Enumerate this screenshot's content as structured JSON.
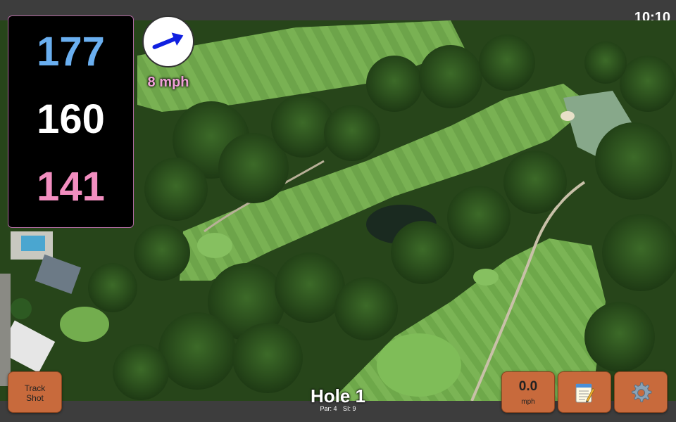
{
  "clock": "10:10",
  "distances": {
    "back": "177",
    "middle": "160",
    "front": "141",
    "colors": {
      "back": "#6aaff0",
      "middle": "#ffffff",
      "front": "#f28ec0"
    }
  },
  "wind": {
    "speed": "8 mph",
    "direction_icon": "arrow-right-up-icon",
    "arrow_color": "#1020e0",
    "text_color": "#f0a0d8"
  },
  "hole": {
    "title": "Hole 1",
    "par": "Par: 4",
    "si": "SI: 9"
  },
  "buttons": {
    "track_shot": {
      "line1": "Track",
      "line2": "Shot"
    },
    "speed": {
      "value": "0.0",
      "unit": "mph"
    },
    "notes": {
      "icon": "notepad-icon"
    },
    "settings": {
      "icon": "gear-icon"
    }
  },
  "colors": {
    "button_bg": "#c86a3c",
    "bar_bg": "#3d3d3d"
  }
}
